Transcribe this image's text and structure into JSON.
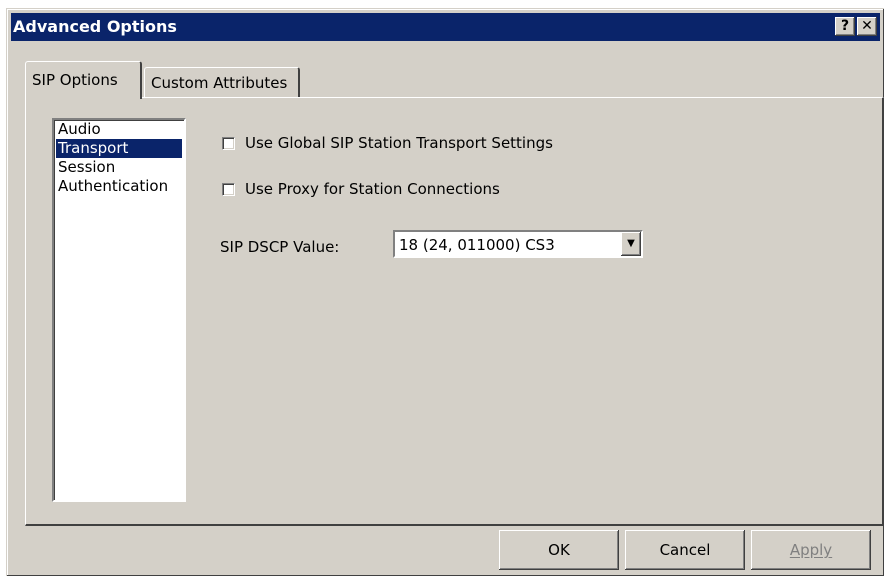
{
  "window": {
    "title": "Advanced Options",
    "help_glyph": "?",
    "close_glyph": "✕"
  },
  "tabs": [
    {
      "label": "SIP Options",
      "active": true
    },
    {
      "label": "Custom Attributes",
      "active": false
    }
  ],
  "sidebar": {
    "items": [
      {
        "label": "Audio",
        "selected": false
      },
      {
        "label": "Transport",
        "selected": true
      },
      {
        "label": "Session",
        "selected": false
      },
      {
        "label": "Authentication",
        "selected": false
      }
    ]
  },
  "transport": {
    "use_global_label": "Use Global SIP Station Transport Settings",
    "use_global_checked": false,
    "use_proxy_label": "Use Proxy for Station Connections",
    "use_proxy_checked": false,
    "dscp_label": "SIP DSCP Value:",
    "dscp_value": "18 (24, 011000) CS3"
  },
  "buttons": {
    "ok": "OK",
    "cancel": "Cancel",
    "apply": "Apply"
  },
  "colors": {
    "title_bar": "#0a246a",
    "dialog_bg": "#d4d0c8",
    "selection": "#0a246a"
  }
}
